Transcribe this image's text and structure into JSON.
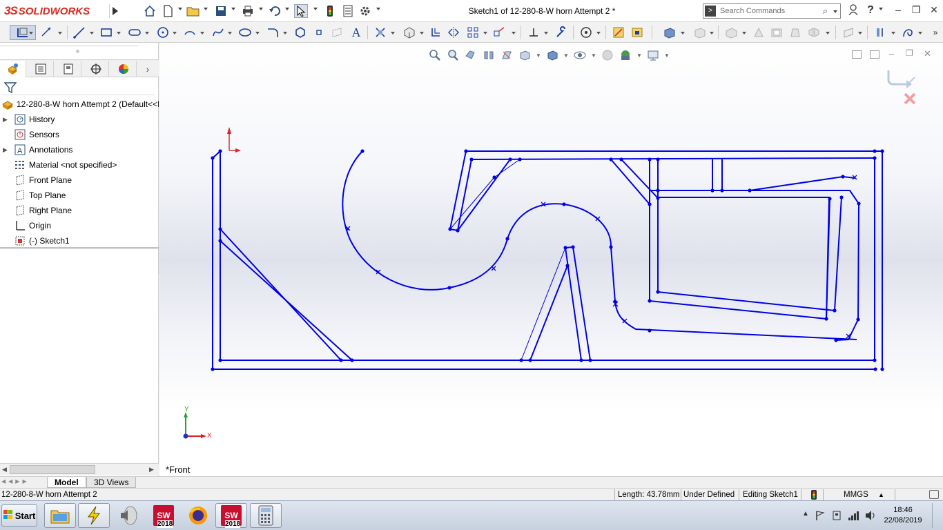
{
  "app": {
    "brand_ds": "3S",
    "brand_name": "SOLIDWORKS",
    "title": "Sketch1 of 12-280-8-W horn Attempt 2 *"
  },
  "search": {
    "placeholder": "Search Commands"
  },
  "feature_tree": {
    "root": "12-280-8-W horn Attempt 2  (Default<<D",
    "items": [
      {
        "label": "History",
        "icon": "history-icon",
        "expandable": true
      },
      {
        "label": "Sensors",
        "icon": "sensors-icon",
        "expandable": false
      },
      {
        "label": "Annotations",
        "icon": "annotations-icon",
        "expandable": true
      },
      {
        "label": "Material <not specified>",
        "icon": "material-icon",
        "expandable": false
      },
      {
        "label": "Front Plane",
        "icon": "plane-icon",
        "expandable": false
      },
      {
        "label": "Top Plane",
        "icon": "plane-icon",
        "expandable": false
      },
      {
        "label": "Right Plane",
        "icon": "plane-icon",
        "expandable": false
      },
      {
        "label": "Origin",
        "icon": "origin-icon",
        "expandable": false
      },
      {
        "label": "(-) Sketch1",
        "icon": "sketch-icon",
        "expandable": false
      }
    ]
  },
  "graphics": {
    "view_label": "*Front",
    "triad_x": "X",
    "triad_y": "Y",
    "sketch_color": "#0000e6"
  },
  "bottom_tabs": {
    "model": "Model",
    "views_3d": "3D Views"
  },
  "status": {
    "document": "12-280-8-W horn Attempt 2",
    "length": "Length: 43.78mm",
    "definition": "Under Defined",
    "editing": "Editing Sketch1",
    "units": "MMGS"
  },
  "taskbar": {
    "start": "Start",
    "sw_version": "2018",
    "time": "18:46",
    "date": "22/08/2019"
  }
}
